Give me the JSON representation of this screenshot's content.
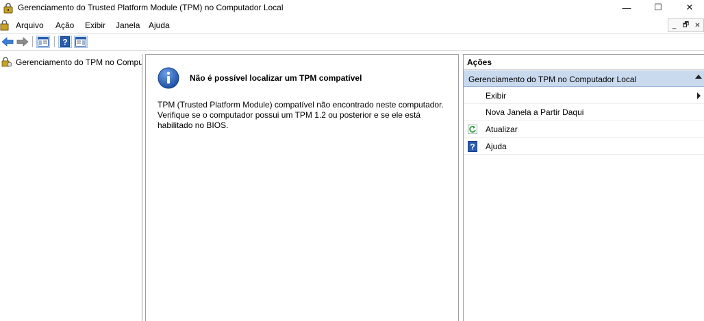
{
  "window": {
    "title": "Gerenciamento do Trusted Platform Module (TPM) no Computador Local",
    "minimize_glyph": "—",
    "maximize_glyph": "☐",
    "close_glyph": "✕"
  },
  "menubar": {
    "items": [
      "Arquivo",
      "Ação",
      "Exibir",
      "Janela",
      "Ajuda"
    ],
    "mdi_minimize": "_",
    "mdi_restore": "🗗",
    "mdi_close": "✕"
  },
  "toolbar": {
    "icons": [
      "back-arrow-icon",
      "forward-arrow-icon",
      "show-hide-console-tree-icon",
      "help-icon",
      "show-hide-action-pane-icon"
    ]
  },
  "tree": {
    "root_label": "Gerenciamento do TPM no Computador Local"
  },
  "content": {
    "title": "Não é possível localizar um TPM compatível",
    "body": "TPM (Trusted Platform Module) compatível não encontrado neste computador. Verifique se o computador possui um TPM 1.2 ou posterior e se ele está habilitado no BIOS."
  },
  "actions": {
    "header": "Ações",
    "section_title": "Gerenciamento do TPM no Computador Local",
    "items": [
      {
        "label": "Exibir",
        "icon": "none",
        "submenu": true
      },
      {
        "label": "Nova Janela a Partir Daqui",
        "icon": "none",
        "submenu": false
      },
      {
        "label": "Atualizar",
        "icon": "refresh-icon",
        "submenu": false
      },
      {
        "label": "Ajuda",
        "icon": "help-icon",
        "submenu": false
      }
    ]
  },
  "colors": {
    "accent_blue": "#2a5db0",
    "section_bg": "#c9d9ee"
  }
}
